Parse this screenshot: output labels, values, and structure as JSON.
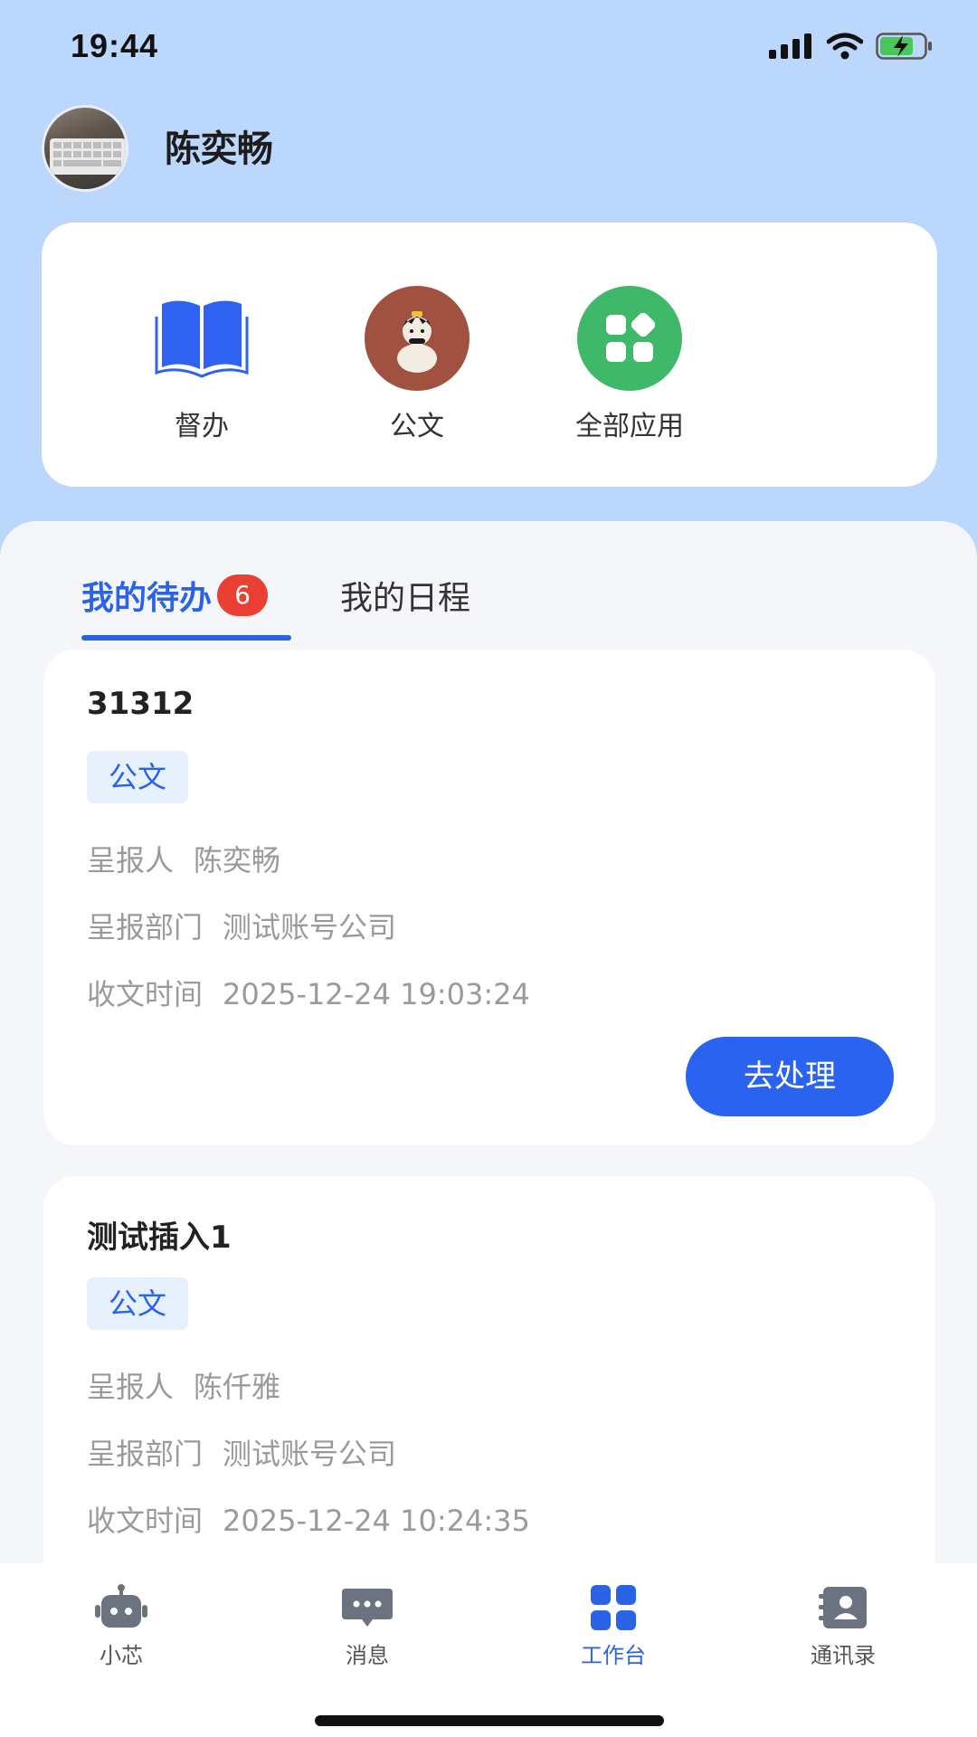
{
  "status_bar": {
    "time": "19:44"
  },
  "header": {
    "user_name": "陈奕畅"
  },
  "quick_apps": [
    {
      "label": "督办",
      "icon": "book-icon",
      "color": "#2f62f0"
    },
    {
      "label": "公文",
      "icon": "cartoon-avatar-icon",
      "color": "#a0513f"
    },
    {
      "label": "全部应用",
      "icon": "apps-grid-icon",
      "color": "#3fb86a"
    }
  ],
  "tabs": [
    {
      "label": "我的待办",
      "badge": "6",
      "active": true
    },
    {
      "label": "我的日程",
      "active": false
    }
  ],
  "tasks": [
    {
      "title": "31312",
      "tag": "公文",
      "reporter_key": "呈报人",
      "reporter": "陈奕畅",
      "dept_key": "呈报部门",
      "dept": "测试账号公司",
      "time_key": "收文时间",
      "time": "2025-12-24 19:03:24",
      "action": "去处理"
    },
    {
      "title": "测试插入1",
      "tag": "公文",
      "reporter_key": "呈报人",
      "reporter": "陈仟雅",
      "dept_key": "呈报部门",
      "dept": "测试账号公司",
      "time_key": "收文时间",
      "time": "2025-12-24 10:24:35"
    }
  ],
  "bottom_nav": [
    {
      "label": "小芯",
      "icon": "robot-icon",
      "active": false
    },
    {
      "label": "消息",
      "icon": "chat-bubble-icon",
      "active": false
    },
    {
      "label": "工作台",
      "icon": "grid-icon",
      "active": true
    },
    {
      "label": "通讯录",
      "icon": "contacts-icon",
      "active": false
    }
  ],
  "colors": {
    "accent": "#2a63e6",
    "badge": "#ea4033",
    "header_bg": "#bcd7fc"
  }
}
